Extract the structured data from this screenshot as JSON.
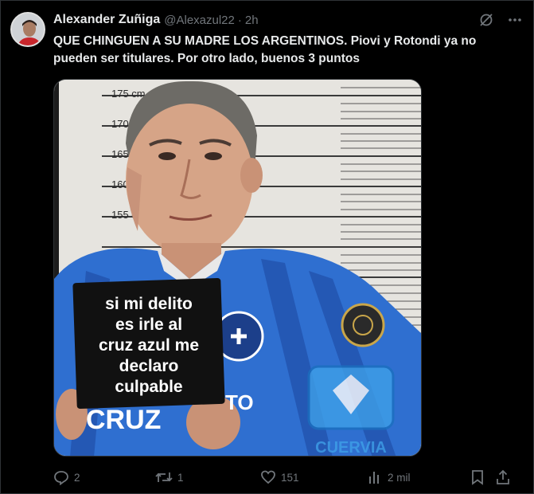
{
  "tweet": {
    "display_name": "Alexander Zuñiga",
    "handle": "@Alexazul22",
    "separator": "·",
    "time": "2h",
    "text": "QUE CHINGUEN A SU MADRE LOS ARGENTINOS. Piovi y Rotondi ya no pueden ser titulares. Por otro lado, buenos 3 puntos",
    "media": {
      "height_marks": [
        "175 cm",
        "170",
        "165",
        "160",
        "155 cm"
      ],
      "sign_lines": [
        "si mi delito",
        "es irle al",
        "cruz azul me",
        "declaro",
        "culpable"
      ],
      "jersey_text": "CRUZ",
      "jersey_text_2": "TO",
      "watermark": "CUERVIA"
    },
    "stats": {
      "replies": "2",
      "retweets": "1",
      "likes": "151",
      "views": "2 mil"
    }
  },
  "colors": {
    "background": "#000000",
    "text": "#e7e9ea",
    "muted": "#71767b",
    "border": "#2f3336",
    "jersey_blue": "#2f6fd0"
  }
}
